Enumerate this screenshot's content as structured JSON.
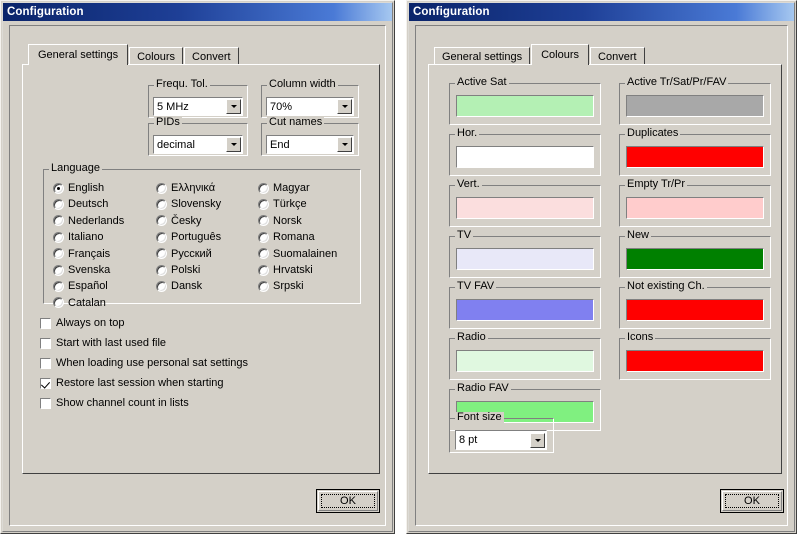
{
  "windows": [
    {
      "title": "Configuration",
      "tabs": [
        {
          "label": "General settings",
          "active": true
        },
        {
          "label": "Colours",
          "active": false
        },
        {
          "label": "Convert",
          "active": false
        }
      ],
      "ok_label": "OK",
      "groups": {
        "frequ_tol": {
          "label": "Frequ. Tol.",
          "value": "5 MHz"
        },
        "column_width": {
          "label": "Column width",
          "value": "70%"
        },
        "pids": {
          "label": "PIDs",
          "value": "decimal"
        },
        "cut_names": {
          "label": "Cut names",
          "value": "End"
        },
        "language": {
          "label": "Language"
        }
      },
      "languages": [
        {
          "label": "English",
          "selected": true,
          "col": 0,
          "row": 0
        },
        {
          "label": "Deutsch",
          "selected": false,
          "col": 0,
          "row": 1
        },
        {
          "label": "Nederlands",
          "selected": false,
          "col": 0,
          "row": 2
        },
        {
          "label": "Italiano",
          "selected": false,
          "col": 0,
          "row": 3
        },
        {
          "label": "Français",
          "selected": false,
          "col": 0,
          "row": 4
        },
        {
          "label": "Svenska",
          "selected": false,
          "col": 0,
          "row": 5
        },
        {
          "label": "Español",
          "selected": false,
          "col": 0,
          "row": 6
        },
        {
          "label": "Catalan",
          "selected": false,
          "col": 0,
          "row": 7
        },
        {
          "label": "Ελληνικά",
          "selected": false,
          "col": 1,
          "row": 0
        },
        {
          "label": "Slovensky",
          "selected": false,
          "col": 1,
          "row": 1
        },
        {
          "label": "Česky",
          "selected": false,
          "col": 1,
          "row": 2
        },
        {
          "label": "Português",
          "selected": false,
          "col": 1,
          "row": 3
        },
        {
          "label": "Русский",
          "selected": false,
          "col": 1,
          "row": 4
        },
        {
          "label": "Polski",
          "selected": false,
          "col": 1,
          "row": 5
        },
        {
          "label": "Dansk",
          "selected": false,
          "col": 1,
          "row": 6
        },
        {
          "label": "Magyar",
          "selected": false,
          "col": 2,
          "row": 0
        },
        {
          "label": "Türkçe",
          "selected": false,
          "col": 2,
          "row": 1
        },
        {
          "label": "Norsk",
          "selected": false,
          "col": 2,
          "row": 2
        },
        {
          "label": "Romana",
          "selected": false,
          "col": 2,
          "row": 3
        },
        {
          "label": "Suomalainen",
          "selected": false,
          "col": 2,
          "row": 4
        },
        {
          "label": "Hrvatski",
          "selected": false,
          "col": 2,
          "row": 5
        },
        {
          "label": "Srpski",
          "selected": false,
          "col": 2,
          "row": 6
        }
      ],
      "checkboxes": [
        {
          "label": "Always on top",
          "checked": false
        },
        {
          "label": "Start with last used file",
          "checked": false
        },
        {
          "label": "When loading use personal sat settings",
          "checked": false
        },
        {
          "label": "Restore last session when starting",
          "checked": true
        },
        {
          "label": "Show channel count in lists",
          "checked": false
        }
      ]
    },
    {
      "title": "Configuration",
      "tabs": [
        {
          "label": "General settings",
          "active": false
        },
        {
          "label": "Colours",
          "active": true
        },
        {
          "label": "Convert",
          "active": false
        }
      ],
      "ok_label": "OK",
      "colours_left": [
        {
          "label": "Active Sat",
          "color": "#b4f0b4"
        },
        {
          "label": "Hor.",
          "color": "#ffffff"
        },
        {
          "label": "Vert.",
          "color": "#fbdede"
        },
        {
          "label": "TV",
          "color": "#e8e8f8"
        },
        {
          "label": "TV FAV",
          "color": "#8080f0"
        },
        {
          "label": "Radio",
          "color": "#e0f8e0"
        },
        {
          "label": "Radio FAV",
          "color": "#80f080"
        }
      ],
      "colours_right": [
        {
          "label": "Active Tr/Sat/Pr/FAV",
          "color": "#a8a8a8"
        },
        {
          "label": "Duplicates",
          "color": "#ff0000"
        },
        {
          "label": "Empty Tr/Pr",
          "color": "#ffcccc"
        },
        {
          "label": "New",
          "color": "#008000"
        },
        {
          "label": "Not existing Ch.",
          "color": "#ff0000"
        },
        {
          "label": "Icons",
          "color": "#ff0000"
        }
      ],
      "font_size": {
        "label": "Font size",
        "value": "8 pt"
      }
    }
  ]
}
